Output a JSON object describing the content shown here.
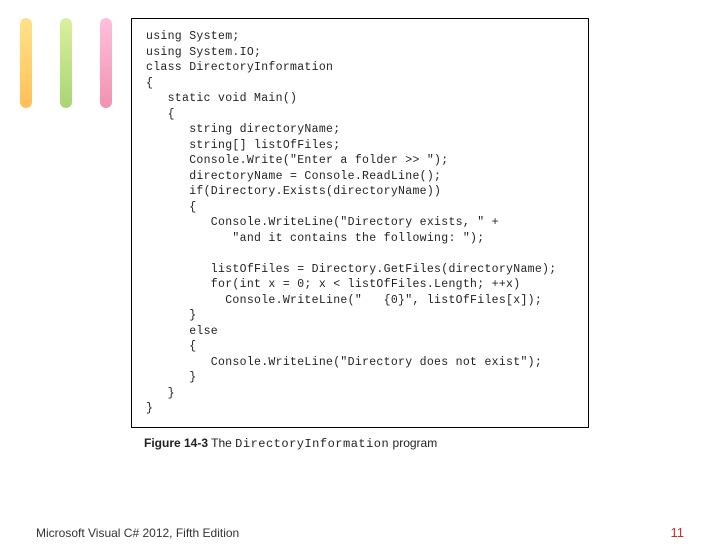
{
  "code": "using System;\nusing System.IO;\nclass DirectoryInformation\n{\n   static void Main()\n   {\n      string directoryName;\n      string[] listOfFiles;\n      Console.Write(\"Enter a folder >> \");\n      directoryName = Console.ReadLine();\n      if(Directory.Exists(directoryName))\n      {\n         Console.WriteLine(\"Directory exists, \" +\n            \"and it contains the following: \");\n\n         listOfFiles = Directory.GetFiles(directoryName);\n         for(int x = 0; x < listOfFiles.Length; ++x)\n           Console.WriteLine(\"   {0}\", listOfFiles[x]);\n      }\n      else\n      {\n         Console.WriteLine(\"Directory does not exist\");\n      }\n   }\n}",
  "caption": {
    "label": "Figure 14-3",
    "desc": "The ",
    "program": "DirectoryInformation",
    "after": " program"
  },
  "footer": {
    "left": "Microsoft Visual C# 2012, Fifth Edition",
    "right": "11"
  }
}
